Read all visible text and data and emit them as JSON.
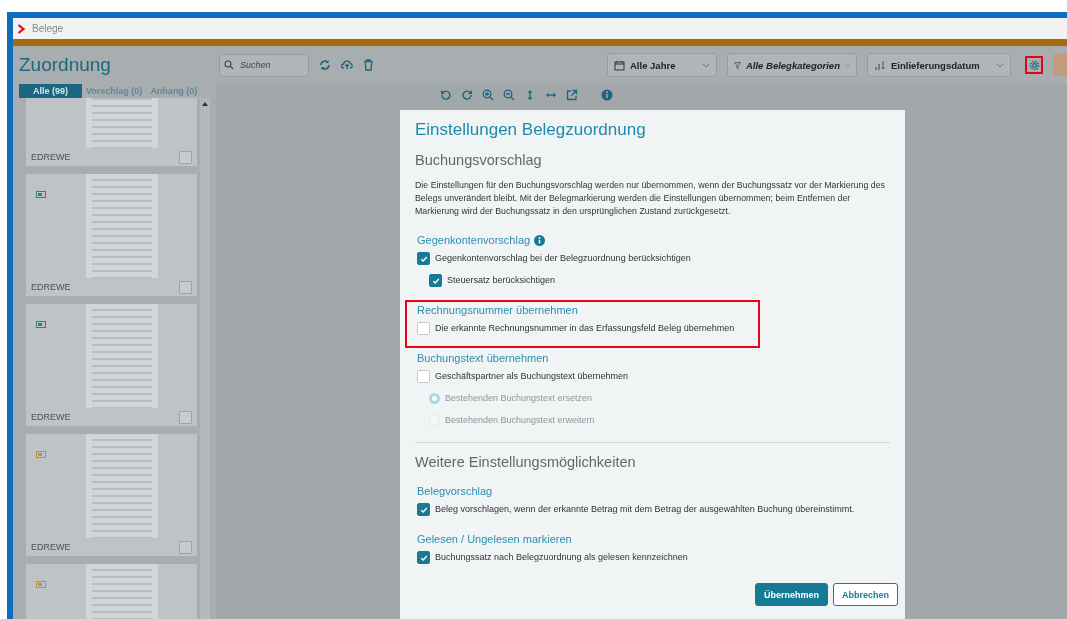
{
  "window": {
    "title": "Belege"
  },
  "header": {
    "title": "Zuordnung",
    "search": {
      "placeholder": "Suchen"
    },
    "filters": [
      {
        "kind": "calendar",
        "label": "Alle Jahre",
        "italic": false
      },
      {
        "kind": "filter",
        "label": "Alle Belegkategorien",
        "italic": true
      },
      {
        "kind": "sort",
        "label": "Einlieferungsdatum",
        "italic": false
      }
    ],
    "settings_button": {
      "highlighted": true
    }
  },
  "tabs": [
    {
      "label": "Alle (99)",
      "selected": true
    },
    {
      "label": "Vorschlag (0)",
      "selected": false
    },
    {
      "label": "Anhang (0)",
      "selected": false
    }
  ],
  "documents": [
    {
      "name": "EDREWE",
      "checked": false
    },
    {
      "name": "EDREWE",
      "color": "#2a8a62",
      "checked": false
    },
    {
      "name": "EDREWE",
      "color": "#2a8a62",
      "checked": false
    },
    {
      "name": "EDREWE",
      "color": "#cf8a30",
      "checked": false
    },
    {
      "color": "#cf8a30"
    }
  ],
  "dialog": {
    "title": "Einstellungen Belegzuordnung",
    "groups": [
      {
        "heading": "Buchungsvorschlag",
        "text": "Die Einstellungen für den Buchungsvorschlag werden nur übernommen, wenn der Buchungssatz vor der Markierung des Belegs unverändert bleibt. Mit der Belegmarkierung werden die Einstellungen übernommen; beim Entfernen der Markierung wird der Buchungssatz in den ursprünglichen Zustand zurückgesetzt.",
        "sections": [
          {
            "title": "Gegenkontenvorschlag",
            "info": true,
            "highlighted": false,
            "options": [
              {
                "kind": "checkbox",
                "label": "Gegenkontenvorschlag bei der Belegzuordnung berücksichtigen",
                "checked": true,
                "disabled": false,
                "children": [
                  {
                    "kind": "checkbox",
                    "label": "Steuersatz berücksichtigen",
                    "checked": true,
                    "disabled": false
                  }
                ]
              }
            ]
          },
          {
            "title": "Rechnungsnummer übernehmen",
            "info": false,
            "highlighted": true,
            "options": [
              {
                "kind": "checkbox",
                "label": "Die erkannte Rechnungsnummer in das Erfassungsfeld Beleg übernehmen",
                "checked": false,
                "disabled": false
              }
            ]
          },
          {
            "title": "Buchungstext übernehmen",
            "info": false,
            "highlighted": false,
            "options": [
              {
                "kind": "checkbox",
                "label": "Geschäftspartner als Buchungstext übernehmen",
                "checked": false,
                "disabled": false,
                "children": [
                  {
                    "kind": "radio",
                    "label": "Bestehenden Buchungstext ersetzen",
                    "selected": true,
                    "disabled": true
                  },
                  {
                    "kind": "radio",
                    "label": "Bestehenden Buchungstext erweitern",
                    "selected": false,
                    "disabled": true
                  }
                ]
              }
            ]
          }
        ]
      },
      {
        "heading": "Weitere Einstellungsmöglichkeiten",
        "sections": [
          {
            "title": "Belegvorschlag",
            "info": false,
            "highlighted": false,
            "options": [
              {
                "kind": "checkbox",
                "label": "Beleg vorschlagen, wenn der erkannte Betrag mit dem Betrag der ausgewählten Buchung übereinstimmt.",
                "checked": true,
                "disabled": false
              }
            ]
          },
          {
            "title": "Gelesen / Ungelesen markieren",
            "info": false,
            "highlighted": false,
            "options": [
              {
                "kind": "checkbox",
                "label": "Buchungssatz nach Belegzuordnung als gelesen kennzeichnen",
                "checked": true,
                "disabled": false
              }
            ]
          }
        ]
      }
    ],
    "buttons": [
      {
        "kind": "primary",
        "label": "Übernehmen"
      },
      {
        "kind": "secondary",
        "label": "Abbrechen"
      }
    ]
  }
}
